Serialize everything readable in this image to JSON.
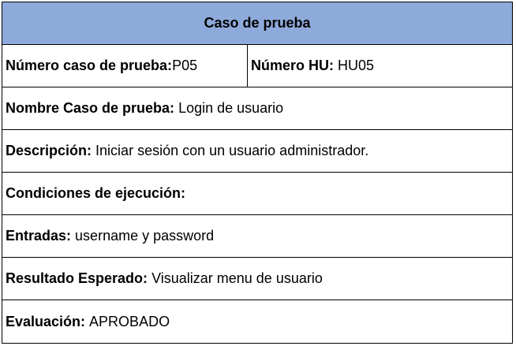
{
  "header": {
    "title": "Caso de prueba",
    "background": "#8eaadb"
  },
  "test_case_number": {
    "label": "Número caso de prueba:",
    "value": "P05"
  },
  "hu_number": {
    "label": "Número HU:",
    "value": "HU05"
  },
  "name": {
    "label": "Nombre Caso de prueba:",
    "value": "Login de usuario"
  },
  "description": {
    "label": "Descripción:",
    "value": "Iniciar sesión con un usuario administrador."
  },
  "conditions": {
    "label": "Condiciones de ejecución:",
    "value": ""
  },
  "inputs": {
    "label": "Entradas:",
    "value": "username y password"
  },
  "expected": {
    "label": "Resultado Esperado:",
    "value": "Visualizar menu de usuario"
  },
  "evaluation": {
    "label": "Evaluación:",
    "value": "APROBADO"
  }
}
